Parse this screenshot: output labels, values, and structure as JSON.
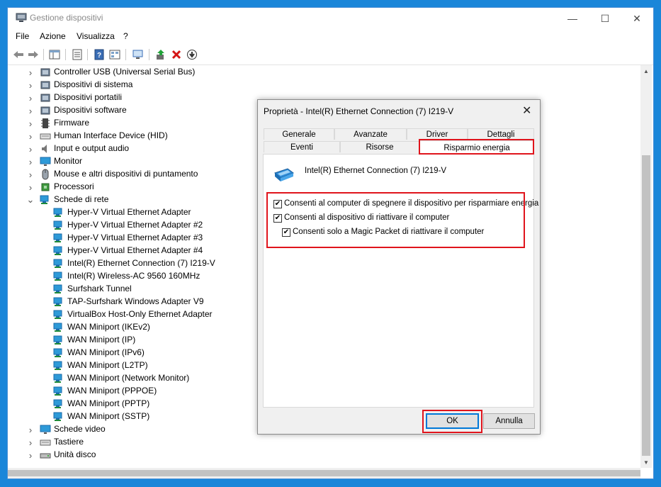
{
  "window": {
    "title": "Gestione dispositivi",
    "controls": [
      "—",
      "☐",
      "✕"
    ]
  },
  "menu": [
    "File",
    "Azione",
    "Visualizza",
    "?"
  ],
  "toolbar": [
    "back-icon",
    "forward-icon",
    "show-hide-tree-icon",
    "properties-icon",
    "help-icon",
    "view-icon",
    "scan-hardware-icon",
    "update-driver-icon",
    "uninstall-icon",
    "disable-icon"
  ],
  "tree": {
    "categories_before": [
      {
        "label": "Controller USB (Universal Serial Bus)",
        "icon": "usb-controller-icon"
      },
      {
        "label": "Dispositivi di sistema",
        "icon": "system-device-icon"
      },
      {
        "label": "Dispositivi portatili",
        "icon": "portable-device-icon"
      },
      {
        "label": "Dispositivi software",
        "icon": "software-device-icon"
      },
      {
        "label": "Firmware",
        "icon": "firmware-icon"
      },
      {
        "label": "Human Interface Device (HID)",
        "icon": "hid-icon"
      },
      {
        "label": "Input e output audio",
        "icon": "audio-icon"
      },
      {
        "label": "Monitor",
        "icon": "monitor-icon"
      },
      {
        "label": "Mouse e altri dispositivi di puntamento",
        "icon": "mouse-icon"
      },
      {
        "label": "Processori",
        "icon": "processor-icon"
      }
    ],
    "network": {
      "label": "Schede di rete",
      "children": [
        "Hyper-V Virtual Ethernet Adapter",
        "Hyper-V Virtual Ethernet Adapter #2",
        "Hyper-V Virtual Ethernet Adapter #3",
        "Hyper-V Virtual Ethernet Adapter #4",
        "Intel(R) Ethernet Connection (7) I219-V",
        "Intel(R) Wireless-AC 9560 160MHz",
        "Surfshark Tunnel",
        "TAP-Surfshark Windows Adapter V9",
        "VirtualBox Host-Only Ethernet Adapter",
        "WAN Miniport (IKEv2)",
        "WAN Miniport (IP)",
        "WAN Miniport (IPv6)",
        "WAN Miniport (L2TP)",
        "WAN Miniport (Network Monitor)",
        "WAN Miniport (PPPOE)",
        "WAN Miniport (PPTP)",
        "WAN Miniport (SSTP)"
      ]
    },
    "categories_after": [
      {
        "label": "Schede video",
        "icon": "display-adapter-icon"
      },
      {
        "label": "Tastiere",
        "icon": "keyboard-icon"
      },
      {
        "label": "Unità disco",
        "icon": "disk-drive-icon"
      }
    ]
  },
  "dialog": {
    "title": "Proprietà - Intel(R) Ethernet Connection (7) I219-V",
    "tabs_row1": [
      "Generale",
      "Avanzate",
      "Driver",
      "Dettagli"
    ],
    "tabs_row2": [
      "Eventi",
      "Risorse",
      "Risparmio energia"
    ],
    "active_tab": "Risparmio energia",
    "device_name": "Intel(R) Ethernet Connection (7) I219-V",
    "options": [
      {
        "label": "Consenti al computer di spegnere il dispositivo per risparmiare energia",
        "checked": true
      },
      {
        "label": "Consenti al dispositivo di riattivare il computer",
        "checked": true
      },
      {
        "label": "Consenti solo a Magic Packet di riattivare il computer",
        "checked": true
      }
    ],
    "ok_label": "OK",
    "cancel_label": "Annulla",
    "highlight_color": "#e0141c"
  }
}
